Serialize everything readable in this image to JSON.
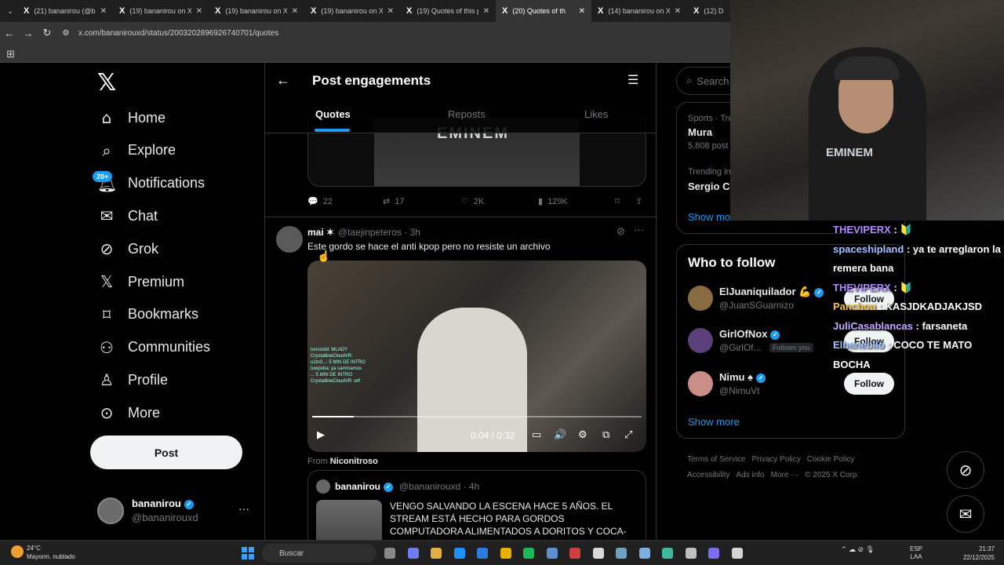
{
  "browser": {
    "tabs": [
      {
        "title": "(21) bananirou (@ba"
      },
      {
        "title": "(19) bananirou on X:"
      },
      {
        "title": "(19) bananirou on X:"
      },
      {
        "title": "(19) bananirou on X:"
      },
      {
        "title": "(19) Quotes of this p"
      },
      {
        "title": "(20) Quotes of th"
      },
      {
        "title": "(14) bananirou on X:"
      },
      {
        "title": "(12) D"
      }
    ],
    "url": "x.com/bananirouxd/status/2003202896926740701/quotes"
  },
  "nav": {
    "items": [
      {
        "label": "Home",
        "icon": "home-icon"
      },
      {
        "label": "Explore",
        "icon": "search-icon"
      },
      {
        "label": "Notifications",
        "icon": "bell-icon"
      },
      {
        "label": "Chat",
        "icon": "mail-icon"
      },
      {
        "label": "Grok",
        "icon": "grok-icon"
      },
      {
        "label": "Premium",
        "icon": "x-logo-icon"
      },
      {
        "label": "Bookmarks",
        "icon": "bookmark-icon"
      },
      {
        "label": "Communities",
        "icon": "people-icon"
      },
      {
        "label": "Profile",
        "icon": "person-icon"
      },
      {
        "label": "More",
        "icon": "more-circle-icon"
      }
    ],
    "notifications_badge": "20+",
    "post_label": "Post",
    "account": {
      "name": "bananirou",
      "handle": "@bananirouxd"
    }
  },
  "header": {
    "title": "Post engagements",
    "tabs": [
      "Quotes",
      "Reposts",
      "Likes"
    ],
    "active_tab": "Quotes"
  },
  "prev_post": {
    "shirt_text": "EMINEM",
    "stats": {
      "replies": "22",
      "reposts": "17",
      "likes": "2K",
      "views": "129K"
    }
  },
  "post": {
    "name": "mai ✶",
    "handle": "@taejinpeteros",
    "time": "3h",
    "text": "Este gordo se hace el anti kpop pero no resiste un archivo",
    "video": {
      "time_display": "0:04 / 0:32",
      "progress": 0.125,
      "chat_lines": "tunnoobi: MLADY\nCrystallineCloudVR:\nu1tn0...: 5 MIN DE INTRO\ntuwpoba: ya cammamos\n... 5 MIN DE INTRO\nCrystallineCloudVR: wtf"
    },
    "from_label": "From",
    "from_name": "Niconitroso",
    "quoted": {
      "name": "bananirou",
      "handle": "@bananirouxd",
      "time": "4h",
      "text": "VENGO SALVANDO LA ESCENA HACE 5 AÑOS. EL STREAM ESTÁ HECHO PARA GORDOS COMPUTADORA ALIMENTADOS A DORITOS Y COCA-"
    }
  },
  "right": {
    "search_placeholder": "Search",
    "trends": [
      {
        "category": "Sports · Tre",
        "name": "Mura",
        "count": "5,808 post"
      },
      {
        "category": "Trending in",
        "name": "Sergio Co"
      }
    ],
    "trends_show_more": "Show mo",
    "who_to_follow": {
      "title": "Who to follow",
      "accounts": [
        {
          "name": "ElJuaniquilador 💪",
          "handle": "@JuanSGuarnizo",
          "follows_you": "",
          "button": "Follow",
          "color": "#8a6a40"
        },
        {
          "name": "GirlOfNox",
          "handle": "@GirlOf...",
          "follows_you": "Follows you",
          "button": "Follow",
          "color": "#5a3f7a"
        },
        {
          "name": "Nimu ♠",
          "handle": "@NimuVt",
          "follows_you": "",
          "button": "Follow",
          "color": "#c98f86"
        }
      ],
      "show_more": "Show more"
    },
    "footer": [
      "Terms of Service",
      "Privacy Policy",
      "Cookie Policy",
      "Accessibility",
      "Ads info",
      "More ···",
      "© 2025 X Corp."
    ]
  },
  "stream_overlay": {
    "shirt_text": "EMINEM",
    "chat": [
      {
        "user": "THEVIPERX",
        "message": ": 🔰"
      },
      {
        "user": "spaceshipland",
        "message": ": ya te arreglaron la remera bana"
      },
      {
        "user": "THEVIPERX",
        "message": ": 🔰"
      },
      {
        "user": "Panchou",
        "message": ": KASJDKADJAKJSD"
      },
      {
        "user": "JuliCasablancas",
        "message": ": farsaneta"
      },
      {
        "user": "Elbanebilo",
        "message": ": COCO TE MATO BOCHA"
      }
    ]
  },
  "taskbar": {
    "weather_temp": "24°C",
    "weather_desc": "Mayorm. nublado",
    "search_label": "Buscar",
    "lang_top": "ESP",
    "lang_bottom": "LAA",
    "time": "21:37",
    "date": "22/12/2025"
  }
}
